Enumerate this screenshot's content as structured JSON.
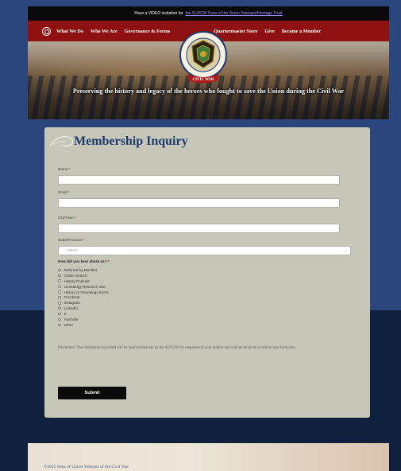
{
  "announcement": {
    "text": "Have a VIDEO invitation for",
    "link": "the SUVCW Sons of the Union Veterans/Heritage Trust"
  },
  "nav": {
    "items": [
      "What We Do",
      "Who We Are",
      "Governance & Forms"
    ],
    "right_items": [
      "Quartermaster Store",
      "Give",
      "Become a Member"
    ]
  },
  "logo": {
    "ring_text_top": "SONS OF UNION VETERANS",
    "ribbon_text": "CIVIL WAR"
  },
  "hero": {
    "tagline": "Preserving the history and legacy of the heroes who fought to save the Union during the Civil War"
  },
  "form": {
    "title": "Membership Inquiry",
    "fields": [
      {
        "label": "Name",
        "required": "*"
      },
      {
        "label": "Email",
        "required": "*"
      },
      {
        "label": "City/Town",
        "required": "*"
      }
    ],
    "state_label": "State/Province",
    "state_required": "*",
    "state_value": "- Select -",
    "question": "How did you hear about us?",
    "question_required": "*",
    "options": [
      "Referred by Member",
      "Online Search",
      "History Podcast",
      "Genealogy Research Site",
      "History or Genealogy Event",
      "Facebook",
      "Instagram",
      "LinkedIn",
      "X",
      "YouTube",
      "Other"
    ],
    "disclaimer": "Disclaimer: The information provided will be used exclusively by the SUVCW for responses to your inquiry and will not be given or sold to any third party.",
    "submit_label": "Submit"
  },
  "footer": {
    "copyright": "©2025 Sons of Union Veterans of the Civil War"
  },
  "colors": {
    "nav_red": "#8e1010",
    "title_blue": "#1f3a6e",
    "card_bg": "#c6c7b8",
    "page_blue": "#2b467c",
    "page_navy": "#0f1f3e"
  }
}
